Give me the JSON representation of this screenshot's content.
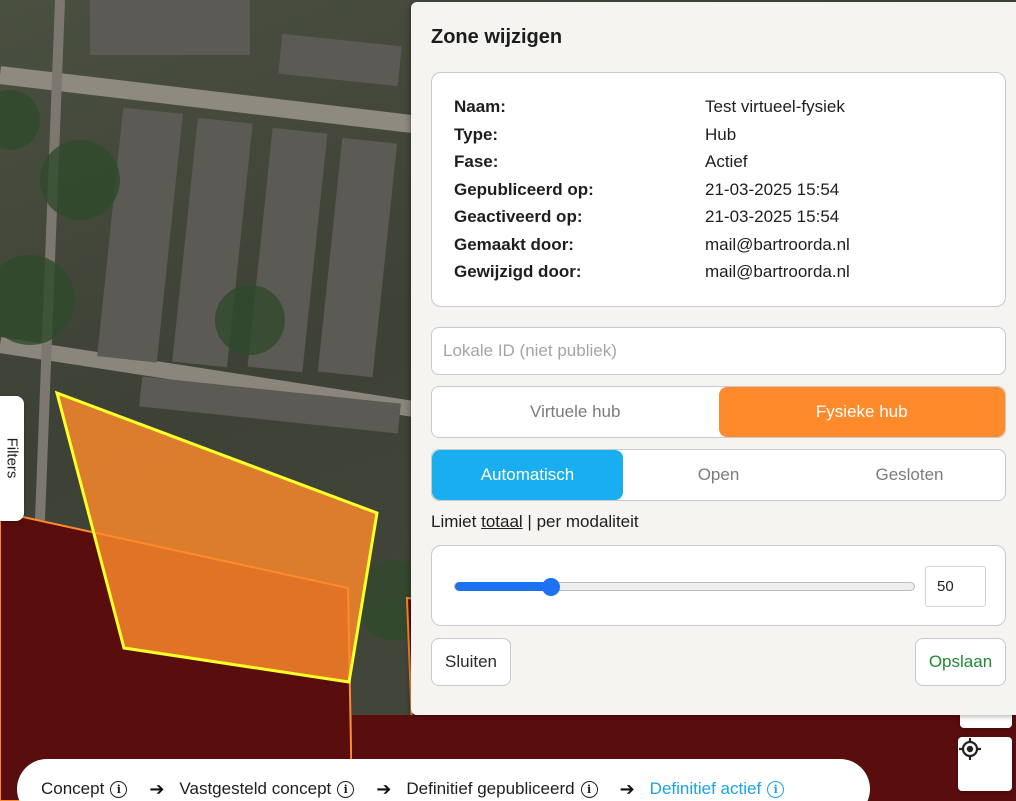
{
  "panel": {
    "title": "Zone wijzigen",
    "details": [
      {
        "key": "Naam:",
        "value": "Test virtueel-fysiek"
      },
      {
        "key": "Type:",
        "value": "Hub"
      },
      {
        "key": "Fase:",
        "value": "Actief"
      },
      {
        "key": "Gepubliceerd op:",
        "value": "21-03-2025 15:54"
      },
      {
        "key": "Geactiveerd op:",
        "value": "21-03-2025 15:54"
      },
      {
        "key": "Gemaakt door:",
        "value": "mail@bartroorda.nl"
      },
      {
        "key": "Gewijzigd door:",
        "value": "mail@bartroorda.nl"
      }
    ],
    "local_id": {
      "placeholder": "Lokale ID (niet publiek)",
      "value": ""
    },
    "hub_type": {
      "options": [
        "Virtuele hub",
        "Fysieke hub"
      ],
      "selected": "Fysieke hub",
      "selected_color": "#ff8a2c"
    },
    "status_mode": {
      "options": [
        "Automatisch",
        "Open",
        "Gesloten"
      ],
      "selected": "Automatisch",
      "selected_color": "#19aef0"
    },
    "limit": {
      "label_prefix": "Limiet",
      "option_total": "totaal",
      "separator": "|",
      "option_per_modality": "per modaliteit",
      "value": "50",
      "slider_fraction": 0.21
    },
    "buttons": {
      "close": "Sluiten",
      "save": "Opslaan"
    }
  },
  "map": {
    "filters_tab": "Filters",
    "zone_fill_color": "#ff8a2c",
    "zone_border_color": "#ffff2a",
    "area_color": "#5a0d0d",
    "locate_icon": "crosshair-icon"
  },
  "status_bar": {
    "steps": [
      {
        "label": "Concept",
        "active": false
      },
      {
        "label": "Vastgesteld concept",
        "active": false
      },
      {
        "label": "Definitief gepubliceerd",
        "active": false
      },
      {
        "label": "Definitief actief",
        "active": true
      }
    ],
    "active_color": "#1aa3e8"
  }
}
